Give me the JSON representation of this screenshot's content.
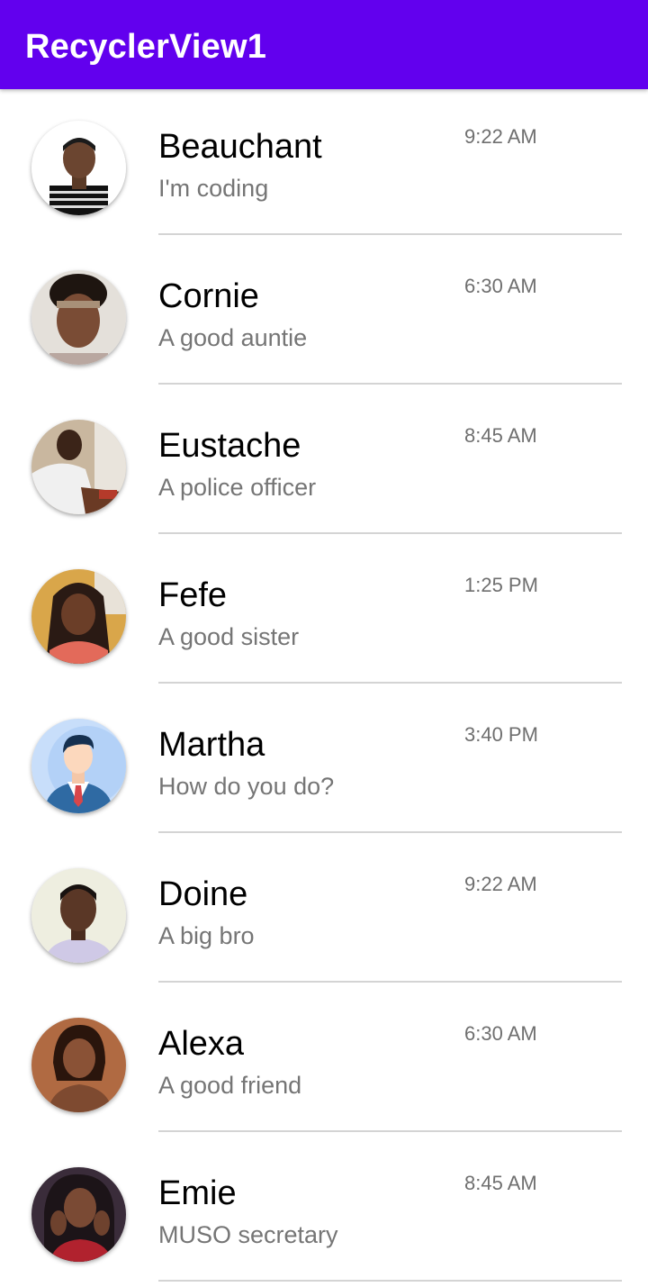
{
  "app_bar": {
    "title": "RecyclerView1",
    "color": "#6200ee"
  },
  "contacts": [
    {
      "name": "Beauchant",
      "status": "I'm coding",
      "time": "9:22 AM",
      "avatar": "person-photo-icon"
    },
    {
      "name": "Cornie",
      "status": "A good auntie",
      "time": "6:30 AM",
      "avatar": "person-photo-icon"
    },
    {
      "name": "Eustache",
      "status": "A police officer",
      "time": "8:45 AM",
      "avatar": "person-photo-icon"
    },
    {
      "name": "Fefe",
      "status": "A good sister",
      "time": "1:25 PM",
      "avatar": "person-photo-icon"
    },
    {
      "name": "Martha",
      "status": "How do you do?",
      "time": "3:40 PM",
      "avatar": "businessman-avatar-icon"
    },
    {
      "name": "Doine",
      "status": "A big bro",
      "time": "9:22 AM",
      "avatar": "person-photo-icon"
    },
    {
      "name": "Alexa",
      "status": "A good friend",
      "time": "6:30 AM",
      "avatar": "person-photo-icon"
    },
    {
      "name": "Emie",
      "status": "MUSO secretary",
      "time": "8:45 AM",
      "avatar": "person-photo-icon"
    }
  ]
}
